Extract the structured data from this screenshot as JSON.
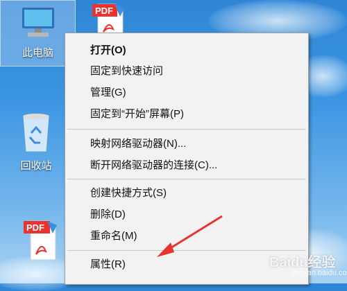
{
  "desktop": {
    "icons": [
      {
        "label": "此电脑"
      },
      {
        "label": "回收站"
      },
      {
        "label": ""
      },
      {
        "label": ""
      }
    ],
    "pdf_badge": "PDF"
  },
  "context_menu": {
    "items": [
      {
        "label": "打开(O)"
      },
      {
        "label": "固定到快速访问"
      },
      {
        "label": "管理(G)"
      },
      {
        "label": "固定到“开始”屏幕(P)"
      },
      {
        "label": "映射网络驱动器(N)..."
      },
      {
        "label": "断开网络驱动器的连接(C)..."
      },
      {
        "label": "创建快捷方式(S)"
      },
      {
        "label": "删除(D)"
      },
      {
        "label": "重命名(M)"
      },
      {
        "label": "属性(R)"
      }
    ]
  },
  "watermark": {
    "brand": "Baidu经验",
    "sub": "jingyan.baidu.com"
  },
  "colors": {
    "arrow": "#e8332f",
    "menu_bg": "#f2f2f2"
  }
}
